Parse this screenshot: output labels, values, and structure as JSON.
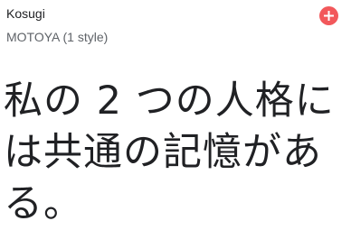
{
  "font": {
    "name": "Kosugi",
    "designer_styles": "MOTOYA (1 style)"
  },
  "add_button": {
    "icon": "plus-icon",
    "color": "#f2585b"
  },
  "sample_text": "私の 2 つの人格には共通の記憶がある。"
}
